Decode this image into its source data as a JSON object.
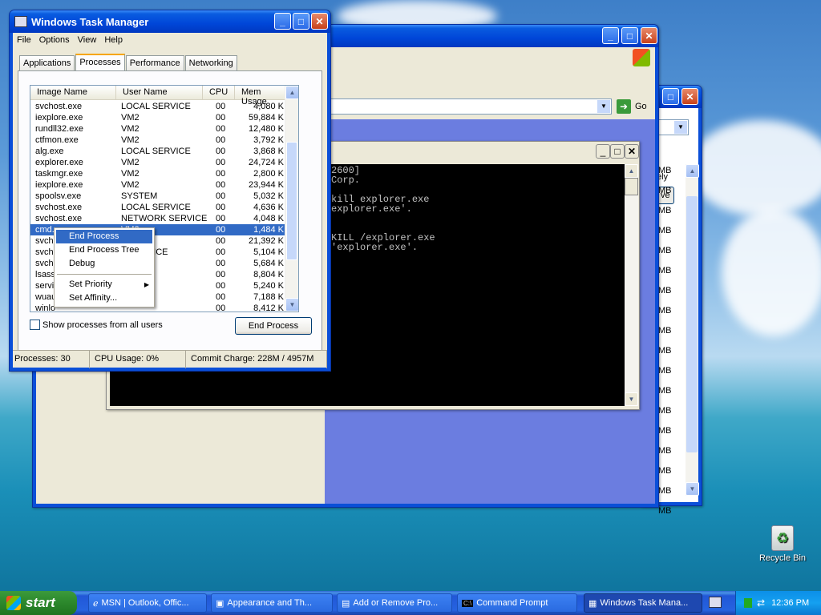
{
  "taskmanager": {
    "title": "Windows Task Manager",
    "menu": [
      "File",
      "Options",
      "View",
      "Help"
    ],
    "tabs": [
      "Applications",
      "Processes",
      "Performance",
      "Networking"
    ],
    "active_tab": "Processes",
    "columns": [
      "Image Name",
      "User Name",
      "CPU",
      "Mem Usage"
    ],
    "rows": [
      {
        "name": "svchost.exe",
        "user": "LOCAL SERVICE",
        "cpu": "00",
        "mem": "4,080 K"
      },
      {
        "name": "iexplore.exe",
        "user": "VM2",
        "cpu": "00",
        "mem": "59,884 K"
      },
      {
        "name": "rundll32.exe",
        "user": "VM2",
        "cpu": "00",
        "mem": "12,480 K"
      },
      {
        "name": "ctfmon.exe",
        "user": "VM2",
        "cpu": "00",
        "mem": "3,792 K"
      },
      {
        "name": "alg.exe",
        "user": "LOCAL SERVICE",
        "cpu": "00",
        "mem": "3,868 K"
      },
      {
        "name": "explorer.exe",
        "user": "VM2",
        "cpu": "00",
        "mem": "24,724 K"
      },
      {
        "name": "taskmgr.exe",
        "user": "VM2",
        "cpu": "00",
        "mem": "2,800 K"
      },
      {
        "name": "iexplore.exe",
        "user": "VM2",
        "cpu": "00",
        "mem": "23,944 K"
      },
      {
        "name": "spoolsv.exe",
        "user": "SYSTEM",
        "cpu": "00",
        "mem": "5,032 K"
      },
      {
        "name": "svchost.exe",
        "user": "LOCAL SERVICE",
        "cpu": "00",
        "mem": "4,636 K"
      },
      {
        "name": "svchost.exe",
        "user": "NETWORK SERVICE",
        "cpu": "00",
        "mem": "4,048 K"
      },
      {
        "name": "cmd.exe",
        "user": "VM2",
        "cpu": "00",
        "mem": "1,484 K",
        "selected": true
      },
      {
        "name": "svch",
        "user": "",
        "cpu": "00",
        "mem": "21,392 K"
      },
      {
        "name": "svch",
        "user": "K SERVICE",
        "cpu": "00",
        "mem": "5,104 K"
      },
      {
        "name": "svch",
        "user": "",
        "cpu": "00",
        "mem": "5,684 K"
      },
      {
        "name": "lsass",
        "user": "",
        "cpu": "00",
        "mem": "8,804 K"
      },
      {
        "name": "servi",
        "user": "",
        "cpu": "00",
        "mem": "5,240 K"
      },
      {
        "name": "wuau",
        "user": "",
        "cpu": "00",
        "mem": "7,188 K"
      },
      {
        "name": "winlo",
        "user": "",
        "cpu": "00",
        "mem": "8,412 K"
      }
    ],
    "show_all_label": "Show processes from all users",
    "end_process_button": "End Process",
    "status": {
      "processes": "Processes: 30",
      "cpu": "CPU Usage: 0%",
      "commit": "Commit Charge: 228M / 4957M"
    }
  },
  "context_menu": {
    "items": [
      "End Process",
      "End Process Tree",
      "Debug",
      "Set Priority",
      "Set Affinity..."
    ],
    "highlighted": "End Process"
  },
  "console": {
    "lines": [
      "2600]",
      "Corp.",
      "",
      "kill explorer.exe",
      "explorer.exe'.",
      "",
      "",
      "KILL /explorer.exe",
      "'explorer.exe'."
    ]
  },
  "browser": {
    "go_label": "Go"
  },
  "right_window": {
    "col_unit": "MB",
    "partial": [
      "ely",
      "ve"
    ]
  },
  "desktop": {
    "recycle_bin": "Recycle Bin"
  },
  "taskbar": {
    "start": "start",
    "items": [
      "MSN | Outlook, Offic...",
      "Appearance and Th...",
      "Add or Remove Pro...",
      "Command Prompt",
      "Windows Task Mana..."
    ],
    "active": "Windows Task Mana...",
    "clock": "12:36 PM"
  }
}
